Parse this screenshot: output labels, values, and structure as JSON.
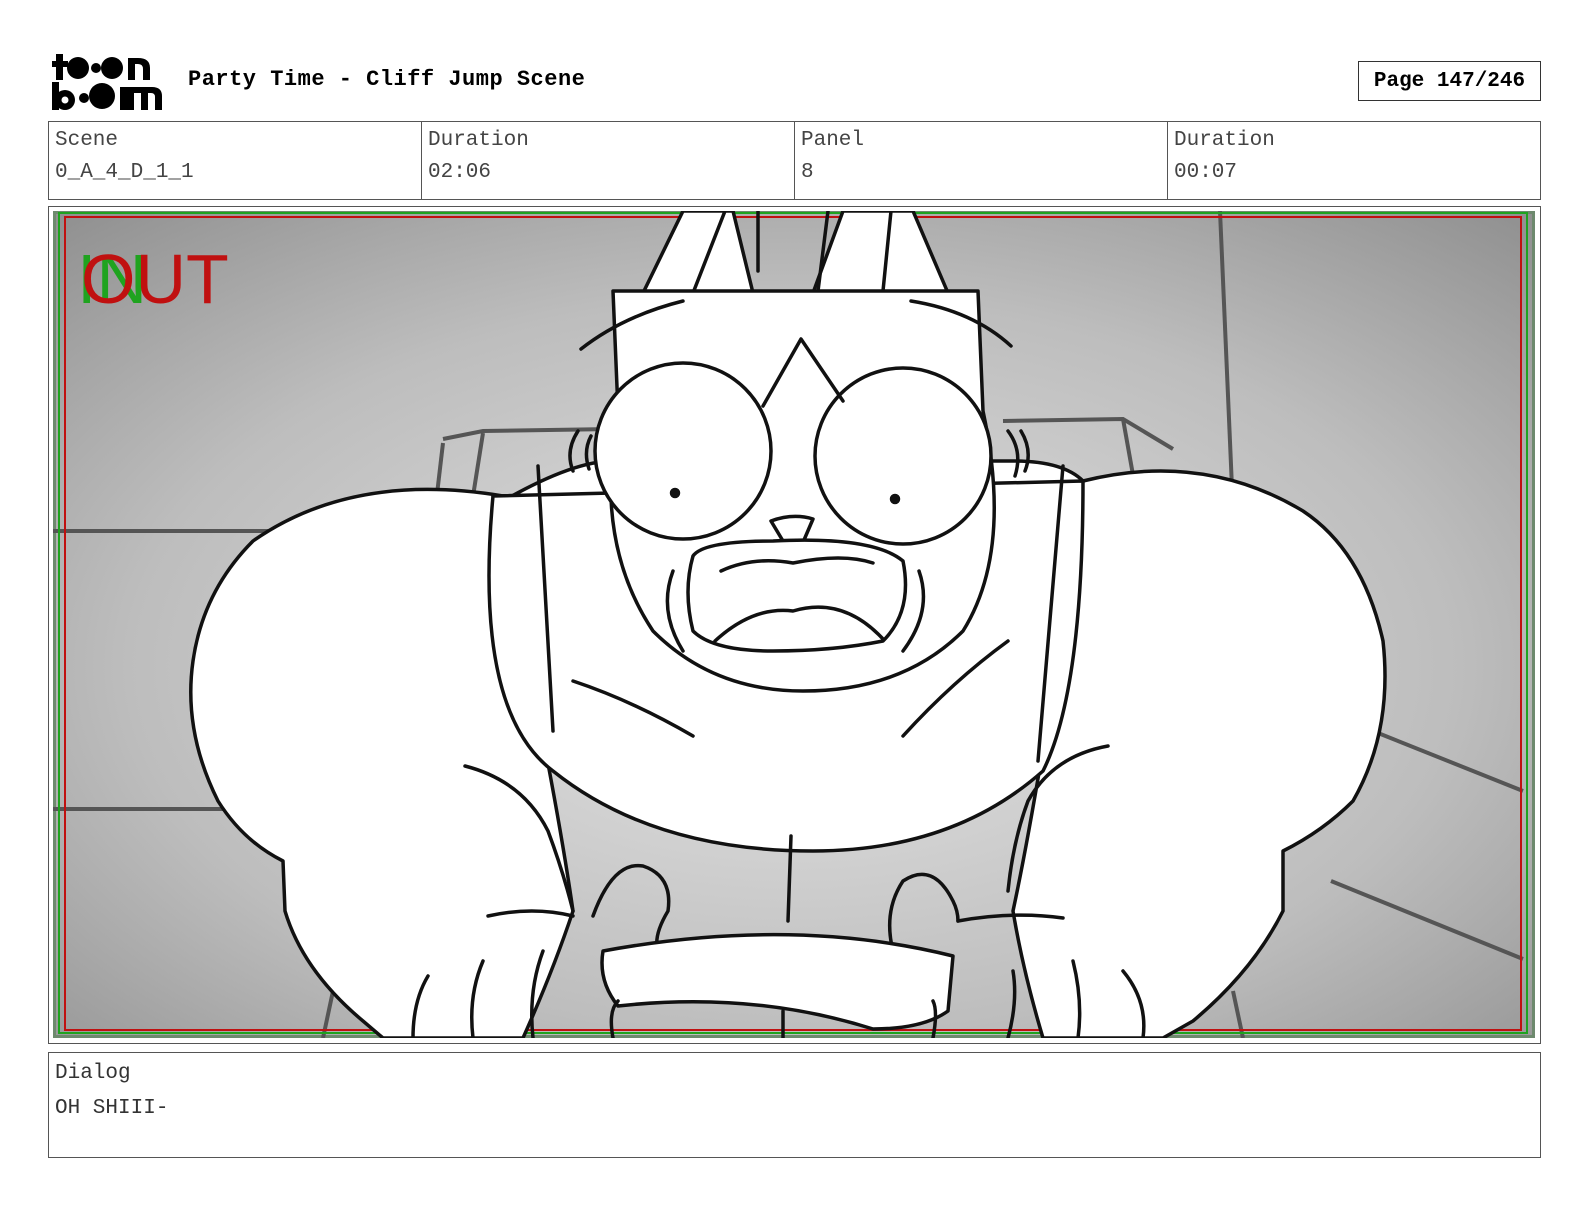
{
  "header": {
    "logo_text_top": "toon",
    "logo_text_bottom": "boom",
    "title": "Party Time - Cliff Jump Scene",
    "page": "Page 147/246"
  },
  "info": {
    "scene_label": "Scene",
    "scene_value": "0_A_4_D_1_1",
    "duration_label": "Duration",
    "duration_value": "02:06",
    "panel_label": "Panel",
    "panel_value": "8",
    "panel_duration_label": "Duration",
    "panel_duration_value": "00:07"
  },
  "panel": {
    "in_marker": "IN",
    "out_marker": "OUT",
    "in_color": "#1fa31f",
    "out_color": "#c01010",
    "safe_frame_colors": [
      "#c01010",
      "#1fa31f"
    ]
  },
  "dialog": {
    "label": "Dialog",
    "text": "OH SHIII-"
  }
}
